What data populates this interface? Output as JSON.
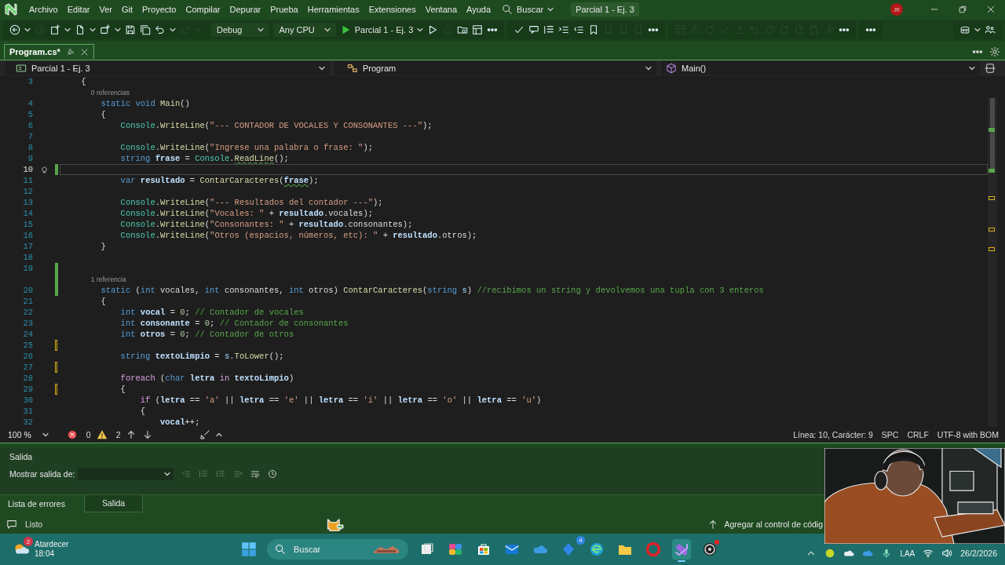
{
  "menu_bar": {
    "items": [
      "Archivo",
      "Editar",
      "Ver",
      "Git",
      "Proyecto",
      "Compilar",
      "Depurar",
      "Prueba",
      "Herramientas",
      "Extensiones",
      "Ventana",
      "Ayuda"
    ],
    "search": "Buscar",
    "solution": "Parcial 1 - Ej. 3",
    "account": "JR"
  },
  "toolbar": {
    "file_tools": [
      {
        "disabled": false
      },
      {
        "disabled": true
      },
      {
        "disabled": false
      },
      {
        "disabled": false
      },
      {
        "disabled": false
      },
      {
        "disabled": false
      },
      {
        "disabled": false
      },
      {
        "disabled": false
      },
      {
        "disabled": true
      }
    ],
    "configuration": "Debug",
    "platform": "Any CPU",
    "start_target": "Parcial 1 - Ej. 3",
    "debug_tools": [
      {
        "disabled": false
      },
      {
        "disabled": true
      },
      {
        "disabled": false
      },
      {
        "disabled": false
      },
      {
        "disabled": false
      }
    ],
    "edit_tools": [
      {
        "disabled": false
      },
      {
        "disabled": false
      },
      {
        "disabled": false
      },
      {
        "disabled": false
      },
      {
        "disabled": false
      },
      {
        "disabled": false
      },
      {
        "disabled": true
      },
      {
        "disabled": true
      },
      {
        "disabled": true
      },
      {
        "disabled": false
      }
    ],
    "source_tools": [
      {
        "disabled": true
      },
      {
        "disabled": true
      },
      {
        "disabled": true
      },
      {
        "disabled": true
      },
      {
        "disabled": true
      },
      {
        "disabled": true
      },
      {
        "disabled": true
      },
      {
        "disabled": true
      },
      {
        "disabled": true
      },
      {
        "disabled": true
      },
      {
        "disabled": true
      },
      {
        "disabled": false
      }
    ]
  },
  "document_tabs": [
    {
      "label": "Program.cs*",
      "selected": true
    }
  ],
  "navigation_bar": {
    "project": "Parcial 1 - Ej. 3",
    "type": "Program",
    "member": "Main()"
  },
  "editor": {
    "lines": [
      {
        "kind": "code",
        "number": "3",
        "current": false,
        "tokens": [
          {
            "kind": "plain",
            "text": "    {"
          }
        ]
      },
      {
        "kind": "codelens",
        "text": "0 referencias"
      },
      {
        "kind": "code",
        "number": "4",
        "current": false,
        "tokens": [
          {
            "kind": "kw",
            "text": "        static "
          },
          {
            "kind": "kw",
            "text": "void "
          },
          {
            "kind": "method",
            "text": "Main"
          },
          {
            "kind": "plain",
            "text": "()"
          }
        ]
      },
      {
        "kind": "code",
        "number": "5",
        "current": false,
        "tokens": [
          {
            "kind": "plain",
            "text": "        {"
          }
        ]
      },
      {
        "kind": "code",
        "number": "6",
        "current": false,
        "tokens": [
          {
            "kind": "type",
            "text": "            Console"
          },
          {
            "kind": "plain",
            "text": "."
          },
          {
            "kind": "method",
            "text": "WriteLine"
          },
          {
            "kind": "plain",
            "text": "("
          },
          {
            "kind": "string",
            "text": "\"--- CONTADOR DE VOCALES Y CONSONANTES ---\""
          },
          {
            "kind": "plain",
            "text": ");"
          }
        ]
      },
      {
        "kind": "code",
        "number": "7",
        "current": false
      },
      {
        "kind": "code",
        "number": "8",
        "current": false,
        "tokens": [
          {
            "kind": "type",
            "text": "            Console"
          },
          {
            "kind": "plain",
            "text": "."
          },
          {
            "kind": "method",
            "text": "WriteLine"
          },
          {
            "kind": "plain",
            "text": "("
          },
          {
            "kind": "string",
            "text": "\"Ingrese una palabra o frase: \""
          },
          {
            "kind": "plain",
            "text": ");"
          }
        ]
      },
      {
        "kind": "code",
        "number": "9",
        "current": false,
        "tokens": [
          {
            "kind": "kw",
            "text": "            string "
          },
          {
            "kind": "local",
            "text": "frase"
          },
          {
            "kind": "plain",
            "text": " = "
          },
          {
            "kind": "type",
            "text": "Console"
          },
          {
            "kind": "plain",
            "text": "."
          },
          {
            "kind": "method",
            "text": "ReadLine",
            "squiggle": true
          },
          {
            "kind": "plain",
            "text": "();"
          }
        ]
      },
      {
        "kind": "code",
        "number": "10",
        "current": true,
        "lightbulb": true,
        "changed": true,
        "saved": true
      },
      {
        "kind": "code",
        "number": "11",
        "current": false,
        "tokens": [
          {
            "kind": "kw",
            "text": "            var "
          },
          {
            "kind": "local",
            "text": "resultado"
          },
          {
            "kind": "plain",
            "text": " = "
          },
          {
            "kind": "method",
            "text": "ContarCaracteres"
          },
          {
            "kind": "plain",
            "text": "("
          },
          {
            "kind": "local",
            "text": "frase",
            "squiggle": true
          },
          {
            "kind": "plain",
            "text": ");"
          }
        ]
      },
      {
        "kind": "code",
        "number": "12",
        "current": false
      },
      {
        "kind": "code",
        "number": "13",
        "current": false,
        "tokens": [
          {
            "kind": "type",
            "text": "            Console"
          },
          {
            "kind": "plain",
            "text": "."
          },
          {
            "kind": "method",
            "text": "WriteLine"
          },
          {
            "kind": "plain",
            "text": "("
          },
          {
            "kind": "string",
            "text": "\"--- Resultados del contador ---\""
          },
          {
            "kind": "plain",
            "text": ");"
          }
        ]
      },
      {
        "kind": "code",
        "number": "14",
        "current": false,
        "tokens": [
          {
            "kind": "type",
            "text": "            Console"
          },
          {
            "kind": "plain",
            "text": "."
          },
          {
            "kind": "method",
            "text": "WriteLine"
          },
          {
            "kind": "plain",
            "text": "("
          },
          {
            "kind": "string",
            "text": "\"Vocales: \""
          },
          {
            "kind": "plain",
            "text": " + "
          },
          {
            "kind": "local",
            "text": "resultado"
          },
          {
            "kind": "plain",
            "text": ".vocales);"
          }
        ]
      },
      {
        "kind": "code",
        "number": "15",
        "current": false,
        "tokens": [
          {
            "kind": "type",
            "text": "            Console"
          },
          {
            "kind": "plain",
            "text": "."
          },
          {
            "kind": "method",
            "text": "WriteLine"
          },
          {
            "kind": "plain",
            "text": "("
          },
          {
            "kind": "string",
            "text": "\"Consonantes: \""
          },
          {
            "kind": "plain",
            "text": " + "
          },
          {
            "kind": "local",
            "text": "resultado"
          },
          {
            "kind": "plain",
            "text": ".consonantes);"
          }
        ]
      },
      {
        "kind": "code",
        "number": "16",
        "current": false,
        "tokens": [
          {
            "kind": "type",
            "text": "            Console"
          },
          {
            "kind": "plain",
            "text": "."
          },
          {
            "kind": "method",
            "text": "WriteLine"
          },
          {
            "kind": "plain",
            "text": "("
          },
          {
            "kind": "string",
            "text": "\"Otros (espacios, números, etc): \""
          },
          {
            "kind": "plain",
            "text": " + "
          },
          {
            "kind": "local",
            "text": "resultado"
          },
          {
            "kind": "plain",
            "text": ".otros);"
          }
        ]
      },
      {
        "kind": "code",
        "number": "17",
        "current": false,
        "tokens": [
          {
            "kind": "plain",
            "text": "        }"
          }
        ]
      },
      {
        "kind": "code",
        "number": "18",
        "current": false
      },
      {
        "kind": "code",
        "number": "19",
        "current": false,
        "changed": true,
        "saved": true
      },
      {
        "kind": "codelens",
        "text": "1 referencia",
        "changed": true,
        "saved": true
      },
      {
        "kind": "code",
        "number": "20",
        "current": false,
        "changed": true,
        "saved": true,
        "tokens": [
          {
            "kind": "kw",
            "text": "        static"
          },
          {
            "kind": "plain",
            "text": " ("
          },
          {
            "kind": "kw",
            "text": "int"
          },
          {
            "kind": "plain",
            "text": " vocales, "
          },
          {
            "kind": "kw",
            "text": "int"
          },
          {
            "kind": "plain",
            "text": " consonantes, "
          },
          {
            "kind": "kw",
            "text": "int"
          },
          {
            "kind": "plain",
            "text": " otros) "
          },
          {
            "kind": "method",
            "text": "ContarCaracteres"
          },
          {
            "kind": "plain",
            "text": "("
          },
          {
            "kind": "kw",
            "text": "string "
          },
          {
            "kind": "param",
            "text": "s"
          },
          {
            "kind": "plain",
            "text": ") "
          },
          {
            "kind": "comment",
            "text": "//recibimos un string y devolvemos una tupla con 3 enteros"
          }
        ]
      },
      {
        "kind": "code",
        "number": "21",
        "current": false,
        "tokens": [
          {
            "kind": "plain",
            "text": "        {"
          }
        ]
      },
      {
        "kind": "code",
        "number": "22",
        "current": false,
        "tokens": [
          {
            "kind": "kw",
            "text": "            int "
          },
          {
            "kind": "local",
            "text": "vocal"
          },
          {
            "kind": "plain",
            "text": " = "
          },
          {
            "kind": "number",
            "text": "0"
          },
          {
            "kind": "plain",
            "text": "; "
          },
          {
            "kind": "comment",
            "text": "// Contador de vocales"
          }
        ]
      },
      {
        "kind": "code",
        "number": "23",
        "current": false,
        "tokens": [
          {
            "kind": "kw",
            "text": "            int "
          },
          {
            "kind": "local",
            "text": "consonante"
          },
          {
            "kind": "plain",
            "text": " = "
          },
          {
            "kind": "number",
            "text": "0"
          },
          {
            "kind": "plain",
            "text": "; "
          },
          {
            "kind": "comment",
            "text": "// Contador de consonantes"
          }
        ]
      },
      {
        "kind": "code",
        "number": "24",
        "current": false,
        "tokens": [
          {
            "kind": "kw",
            "text": "            int "
          },
          {
            "kind": "local",
            "text": "otros"
          },
          {
            "kind": "plain",
            "text": " = "
          },
          {
            "kind": "number",
            "text": "0"
          },
          {
            "kind": "plain",
            "text": "; "
          },
          {
            "kind": "comment",
            "text": "// Contador de otros"
          }
        ]
      },
      {
        "kind": "code",
        "number": "25",
        "current": false,
        "changed": true,
        "saved": false
      },
      {
        "kind": "code",
        "number": "26",
        "current": false,
        "tokens": [
          {
            "kind": "kw",
            "text": "            string "
          },
          {
            "kind": "local",
            "text": "textoLimpio"
          },
          {
            "kind": "plain",
            "text": " = "
          },
          {
            "kind": "param",
            "text": "s"
          },
          {
            "kind": "plain",
            "text": "."
          },
          {
            "kind": "method",
            "text": "ToLower"
          },
          {
            "kind": "plain",
            "text": "();"
          }
        ]
      },
      {
        "kind": "code",
        "number": "27",
        "current": false,
        "changed": true,
        "saved": false
      },
      {
        "kind": "code",
        "number": "28",
        "current": false,
        "tokens": [
          {
            "kind": "ctrl",
            "text": "            foreach"
          },
          {
            "kind": "plain",
            "text": " ("
          },
          {
            "kind": "kw",
            "text": "char "
          },
          {
            "kind": "local",
            "text": "letra "
          },
          {
            "kind": "ctrl",
            "text": "in "
          },
          {
            "kind": "local",
            "text": "textoLimpio"
          },
          {
            "kind": "plain",
            "text": ")"
          }
        ]
      },
      {
        "kind": "code",
        "number": "29",
        "current": false,
        "changed": true,
        "saved": false,
        "tokens": [
          {
            "kind": "plain",
            "text": "            {"
          }
        ]
      },
      {
        "kind": "code",
        "number": "30",
        "current": false,
        "tokens": [
          {
            "kind": "ctrl",
            "text": "                if"
          },
          {
            "kind": "plain",
            "text": " ("
          },
          {
            "kind": "local",
            "text": "letra"
          },
          {
            "kind": "plain",
            "text": " == "
          },
          {
            "kind": "string",
            "text": "'a'"
          },
          {
            "kind": "plain",
            "text": " || "
          },
          {
            "kind": "local",
            "text": "letra"
          },
          {
            "kind": "plain",
            "text": " == "
          },
          {
            "kind": "string",
            "text": "'e'"
          },
          {
            "kind": "plain",
            "text": " || "
          },
          {
            "kind": "local",
            "text": "letra"
          },
          {
            "kind": "plain",
            "text": " == "
          },
          {
            "kind": "string",
            "text": "'i'"
          },
          {
            "kind": "plain",
            "text": " || "
          },
          {
            "kind": "local",
            "text": "letra"
          },
          {
            "kind": "plain",
            "text": " == "
          },
          {
            "kind": "string",
            "text": "'o'"
          },
          {
            "kind": "plain",
            "text": " || "
          },
          {
            "kind": "local",
            "text": "letra"
          },
          {
            "kind": "plain",
            "text": " == "
          },
          {
            "kind": "string",
            "text": "'u'"
          },
          {
            "kind": "plain",
            "text": ")"
          }
        ]
      },
      {
        "kind": "code",
        "number": "31",
        "current": false,
        "tokens": [
          {
            "kind": "plain",
            "text": "                {"
          }
        ]
      },
      {
        "kind": "code",
        "number": "32",
        "current": false,
        "tokens": [
          {
            "kind": "local",
            "text": "                    vocal"
          },
          {
            "kind": "plain",
            "text": "++;"
          }
        ]
      }
    ]
  },
  "editor_status": {
    "zoom": "100 %",
    "errors": "0",
    "warnings": "2",
    "position": "Línea: 10, Carácter: 9",
    "indentation": "SPC",
    "line_endings": "CRLF",
    "encoding": "UTF-8 with BOM"
  },
  "output_panel": {
    "title": "Salida",
    "source_label": "Mostrar salida de:"
  },
  "panel_tabs": [
    {
      "label": "Lista de errores",
      "selected": false
    },
    {
      "label": "Salida",
      "selected": true
    }
  ],
  "status_bar": {
    "state": "Listo",
    "source_control": "Agregar al control de códig"
  },
  "taskbar": {
    "weather": {
      "badge": "2",
      "label": "Atardecer",
      "time": "18:04"
    },
    "search": "Buscar",
    "apps": [
      {
        "active": false,
        "notification": false
      },
      {
        "active": false,
        "notification": false
      },
      {
        "active": false,
        "notification": false
      },
      {
        "active": false,
        "notification": false
      },
      {
        "active": false,
        "notification": false
      },
      {
        "active": false,
        "notification": false,
        "badge": "4"
      },
      {
        "active": false,
        "notification": false
      },
      {
        "active": false,
        "notification": false
      },
      {
        "active": false,
        "notification": false
      },
      {
        "active": true,
        "notification": false
      },
      {
        "active": false,
        "notification": true
      }
    ],
    "language": "LAA",
    "date": "26/2/2026"
  }
}
